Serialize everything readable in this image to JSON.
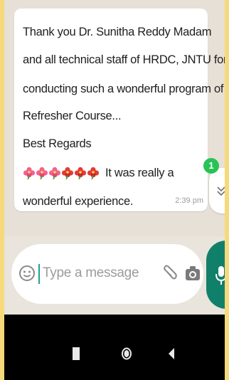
{
  "message": {
    "lines": [
      "Thank you Dr. Sunitha Reddy Madam",
      "and all technical staff of HRDC, JNTU for",
      "conducting such a wonderful program of",
      "Refresher Course...",
      "Best Regards",
      "It was really a",
      "wonderful experience."
    ],
    "emoji": "hibiscus-flowers",
    "time": "2:39 pm"
  },
  "unread_badge": "1",
  "compose": {
    "placeholder": "Type a message"
  },
  "colors": {
    "accent": "#11806a",
    "badge": "#29c257",
    "chat_bg": "#e7e0d6",
    "frame_bg": "#f6d97a"
  }
}
